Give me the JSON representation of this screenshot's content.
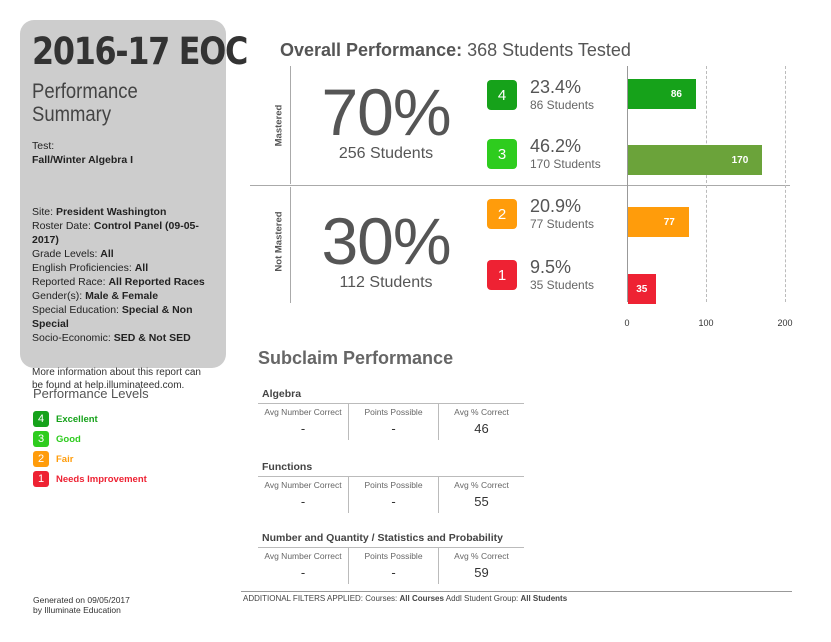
{
  "summary": {
    "year_title": "2016-17 EOC",
    "subtitle_line1": "Performance",
    "subtitle_line2": "Summary",
    "test_label": "Test:",
    "test_value": "Fall/Winter Algebra I",
    "site_label": "Site: ",
    "site_value": "President Washington",
    "roster_label": "Roster Date: ",
    "roster_value": "Control Panel (09-05-2017)",
    "grade_label": "Grade Levels: ",
    "grade_value": "All",
    "english_label": "English Proficiencies: ",
    "english_value": "All",
    "race_label": "Reported Race: ",
    "race_value": "All Reported Races",
    "gender_label": "Gender(s): ",
    "gender_value": " Male & Female",
    "sped_label": "Special Education: ",
    "sped_value": "Special & Non Special",
    "socio_label": "Socio-Economic: ",
    "socio_value": " SED & Not SED",
    "more_info": "More information about this report can be found at help.illuminateed.com."
  },
  "levels": {
    "title": "Performance Levels",
    "items": [
      {
        "num": "4",
        "label": "Excellent",
        "color": "#16a21a"
      },
      {
        "num": "3",
        "label": "Good",
        "color": "#2ecc1e"
      },
      {
        "num": "2",
        "label": "Fair",
        "color": "#ff9c0b"
      },
      {
        "num": "1",
        "label": "Needs Improvement",
        "color": "#ee2233"
      }
    ]
  },
  "footer": {
    "generated": "Generated on 09/05/2017",
    "by": "by Illuminate Education",
    "filters_label": "ADDITIONAL FILTERS APPLIED:  Courses: ",
    "courses_value": "All Courses",
    "group_label": "   Addl Student Group: ",
    "group_value": "All Students"
  },
  "overall": {
    "title": "Overall Performance:",
    "tested": "368 Students Tested",
    "mastered_label": "Mastered",
    "not_mastered_label": "Not Mastered",
    "mastered_pct": "70%",
    "mastered_students": "256 Students",
    "not_mastered_pct": "30%",
    "not_mastered_students": "112 Students",
    "levels": [
      {
        "num": "4",
        "pct": "23.4%",
        "students": "86 Students",
        "color": "#16a21a"
      },
      {
        "num": "3",
        "pct": "46.2%",
        "students": "170 Students",
        "color": "#2ecc1e"
      },
      {
        "num": "2",
        "pct": "20.9%",
        "students": "77 Students",
        "color": "#ff9c0b"
      },
      {
        "num": "1",
        "pct": "9.5%",
        "students": "35 Students",
        "color": "#ee2233"
      }
    ]
  },
  "chart_data": {
    "type": "bar",
    "orientation": "horizontal",
    "categories": [
      "4",
      "3",
      "2",
      "1"
    ],
    "values": [
      86,
      170,
      77,
      35
    ],
    "bar_labels": [
      "86",
      "170",
      "77",
      "35"
    ],
    "colors": [
      "#16a21a",
      "#6ba33a",
      "#ff9c0b",
      "#ee2233"
    ],
    "xlim": [
      0,
      200
    ],
    "xticks": [
      "0",
      "100",
      "200"
    ],
    "grid": true
  },
  "subclaims": {
    "title": "Subclaim Performance",
    "headers": [
      "Avg Number Correct",
      "Points Possible",
      "Avg % Correct"
    ],
    "items": [
      {
        "name": "Algebra",
        "values": [
          "-",
          "-",
          "46"
        ]
      },
      {
        "name": "Functions",
        "values": [
          "-",
          "-",
          "55"
        ]
      },
      {
        "name": "Number and Quantity / Statistics and Probability",
        "values": [
          "-",
          "-",
          "59"
        ]
      }
    ]
  }
}
